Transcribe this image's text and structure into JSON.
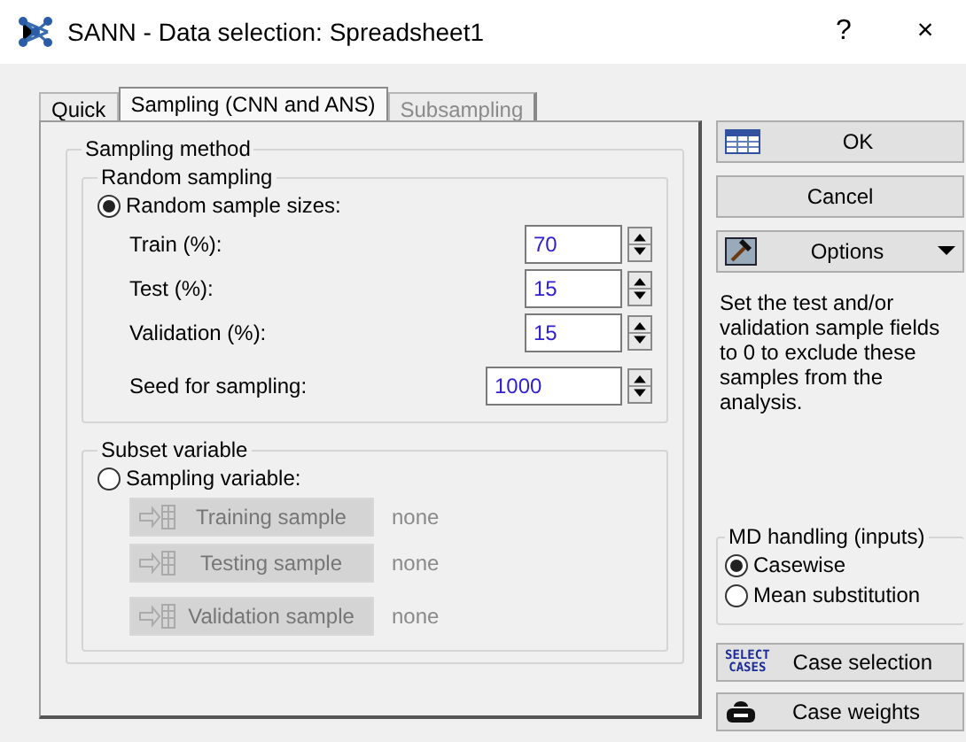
{
  "window": {
    "title": "SANN - Data selection: Spreadsheet1",
    "controls": [
      "?",
      "×"
    ]
  },
  "tabs": [
    {
      "label": "Quick",
      "selected": false,
      "disabled": false
    },
    {
      "label": "Sampling (CNN and ANS)",
      "selected": true,
      "disabled": false
    },
    {
      "label": "Subsampling",
      "selected": false,
      "disabled": true
    }
  ],
  "sampling_method": {
    "title": "Sampling method",
    "random_sampling": {
      "title": "Random sampling",
      "option": {
        "label": "Random sample sizes:",
        "selected": true
      },
      "fields": [
        {
          "label": "Train (%):",
          "value": "70"
        },
        {
          "label": "Test (%):",
          "value": "15"
        },
        {
          "label": "Validation (%):",
          "value": "15"
        }
      ],
      "seed": {
        "label": "Seed for sampling:",
        "value": "1000"
      }
    },
    "subset_variable": {
      "title": "Subset variable",
      "option": {
        "label": "Sampling variable:",
        "selected": false
      },
      "variables": [
        {
          "button": "Training sample",
          "value": "none",
          "disabled": true
        },
        {
          "button": "Testing sample",
          "value": "none",
          "disabled": true
        },
        {
          "button": "Validation sample",
          "value": "none",
          "disabled": true
        }
      ]
    }
  },
  "side": {
    "buttons": [
      {
        "label": "OK",
        "kind": "ok"
      },
      {
        "label": "Cancel",
        "kind": "cancel"
      },
      {
        "label": "Options",
        "kind": "options"
      }
    ],
    "note": "Set the test and/or validation sample fields to 0 to exclude these samples from the analysis.",
    "md_handling": {
      "title": "MD handling (inputs)",
      "options": [
        {
          "label": "Casewise",
          "selected": true
        },
        {
          "label": "Mean substitution",
          "selected": false
        }
      ]
    },
    "bottom_buttons": [
      {
        "label": "Case selection",
        "kind": "select",
        "icon_text": [
          "SELECT",
          "CASES"
        ]
      },
      {
        "label": "Case weights",
        "kind": "weights"
      }
    ]
  }
}
